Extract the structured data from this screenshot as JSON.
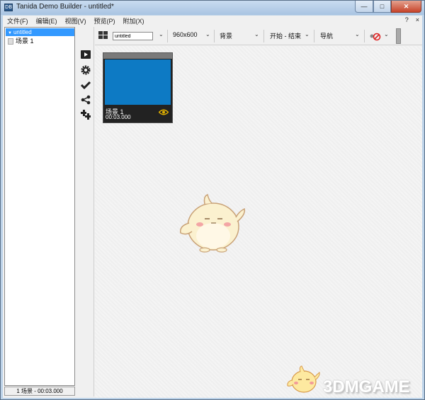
{
  "window": {
    "title": "Tanida Demo Builder - untitled*",
    "app_icon_text": "DB",
    "minimize_glyph": "—",
    "maximize_glyph": "□",
    "close_glyph": "✕"
  },
  "menubar": {
    "items": [
      "文件(F)",
      "编辑(E)",
      "视图(V)",
      "预览(P)",
      "附加(X)"
    ],
    "help_label": "?",
    "close_label": "×"
  },
  "tree": {
    "root_label": "untitled",
    "items": [
      {
        "label": "场景 1"
      }
    ]
  },
  "status": {
    "text": "1 场景 - 00:03.000"
  },
  "toolbar": {
    "project_name": "untitled",
    "resolution": "960x600",
    "background_label": "背景",
    "start_end_label": "开始 - 结束",
    "navigation_label": "导航"
  },
  "scenes": [
    {
      "name": "场景 1",
      "duration": "00:03.000",
      "thumb_color": "#0d7ac4"
    }
  ],
  "tool_icons": [
    "play-icon",
    "gear-icon",
    "checkmark-icon",
    "share-icon",
    "add-scene-icon"
  ],
  "watermark": {
    "text": "3DMGAME"
  },
  "colors": {
    "selection": "#3399ff",
    "scene_thumbnail": "#0d7ac4",
    "eye_accent": "#e0b000"
  }
}
